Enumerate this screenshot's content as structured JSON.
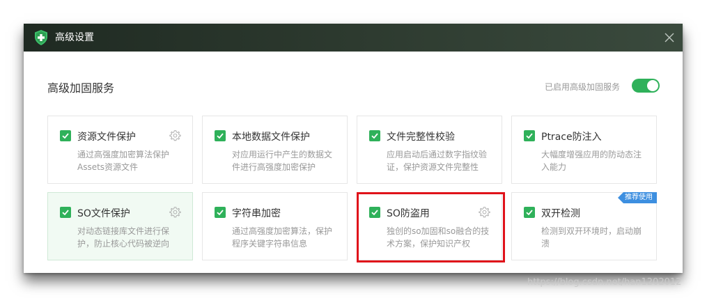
{
  "window": {
    "title": "高级设置"
  },
  "section": {
    "title": "高级加固服务",
    "toggle_label": "已启用高级加固服务",
    "toggle_on": true
  },
  "cards": [
    {
      "title": "资源文件保护",
      "desc": "通过高强度加密算法保护Assets资源文件",
      "checked": true,
      "has_settings": true,
      "selected": false,
      "badge": ""
    },
    {
      "title": "本地数据文件保护",
      "desc": "对应用运行中产生的数据文件进行高强度加密保护",
      "checked": true,
      "has_settings": false,
      "selected": false,
      "badge": ""
    },
    {
      "title": "文件完整性校验",
      "desc": "应用启动后通过数字指纹验证，保护资源文件完整性",
      "checked": true,
      "has_settings": false,
      "selected": false,
      "badge": ""
    },
    {
      "title": "Ptrace防注入",
      "desc": "大幅度增强应用的防动态注入能力",
      "checked": true,
      "has_settings": false,
      "selected": false,
      "badge": ""
    },
    {
      "title": "SO文件保护",
      "desc": "对动态链接库文件进行保护，防止核心代码被逆向",
      "checked": true,
      "has_settings": true,
      "selected": true,
      "badge": ""
    },
    {
      "title": "字符串加密",
      "desc": "通过高强度加密算法，保护程序关键字符串信息",
      "checked": true,
      "has_settings": false,
      "selected": false,
      "badge": ""
    },
    {
      "title": "SO防盗用",
      "desc": "独创的so加固和so融合的技术方案，保护知识产权",
      "checked": true,
      "has_settings": true,
      "selected": false,
      "badge": ""
    },
    {
      "title": "双开检测",
      "desc": "检测到双开环境时，启动崩溃",
      "checked": true,
      "has_settings": false,
      "selected": false,
      "badge": "推荐使用"
    }
  ],
  "watermark": "https://blog.csdn.net/han1202012",
  "colors": {
    "accent": "#2fb15a",
    "badge": "#3d8fe0",
    "highlight": "#e0121a"
  }
}
